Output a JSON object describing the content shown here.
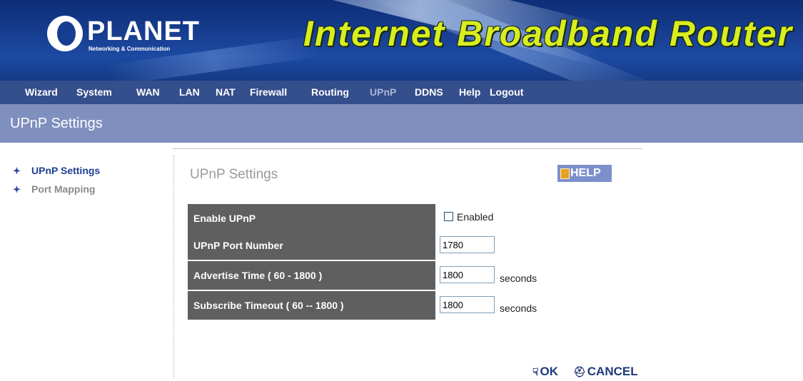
{
  "banner": {
    "brand": "PLANET",
    "brand_tagline": "Networking & Communication",
    "product_title": "Internet Broadband Router"
  },
  "menu": {
    "items": [
      {
        "label": "Wizard"
      },
      {
        "label": "System"
      },
      {
        "label": "WAN"
      },
      {
        "label": "LAN"
      },
      {
        "label": "NAT"
      },
      {
        "label": "Firewall"
      },
      {
        "label": "Routing"
      },
      {
        "label": "UPnP"
      },
      {
        "label": "DDNS"
      },
      {
        "label": "Help"
      },
      {
        "label": "Logout"
      }
    ],
    "active": "UPnP"
  },
  "section": {
    "title": "UPnP Settings"
  },
  "sidebar": {
    "items": [
      {
        "label": "UPnP Settings",
        "active": true
      },
      {
        "label": "Port Mapping",
        "active": false
      }
    ]
  },
  "content": {
    "title": "UPnP Settings",
    "help_label": "HELP",
    "rows": [
      {
        "label": "Enable UPnP",
        "checkbox_label": "Enabled",
        "checked": false
      },
      {
        "label": "UPnP Port Number",
        "value": "1780"
      },
      {
        "label": "Advertise Time ( 60 - 1800 )",
        "value": "1800",
        "unit": "seconds"
      },
      {
        "label": "Subscribe Timeout ( 60 -- 1800 )",
        "value": "1800",
        "unit": "seconds"
      }
    ]
  },
  "actions": {
    "ok_label": "OK",
    "cancel_label": "CANCEL"
  },
  "colors": {
    "menu_bg": "#354e8c",
    "section_bg": "#7f8fbe",
    "row_label_bg": "#5f5f5f",
    "banner_title": "#d8ee20",
    "help_bg": "#7c8fca"
  }
}
